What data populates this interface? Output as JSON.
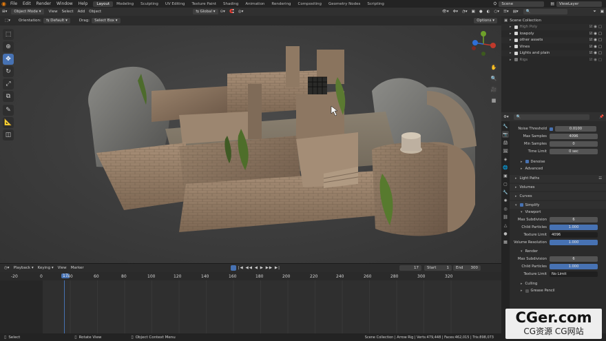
{
  "topbar": {
    "menu": [
      "File",
      "Edit",
      "Render",
      "Window",
      "Help"
    ],
    "workspaces": [
      "Layout",
      "Modeling",
      "Sculpting",
      "UV Editing",
      "Texture Paint",
      "Shading",
      "Animation",
      "Rendering",
      "Compositing",
      "Geometry Nodes",
      "Scripting"
    ],
    "active_workspace": "Layout",
    "scene": "Scene",
    "view_layer": "ViewLayer"
  },
  "viewport_header": {
    "mode": "Object Mode",
    "menu": [
      "View",
      "Select",
      "Add",
      "Object"
    ],
    "transform": "Global"
  },
  "viewport_tool": {
    "orientation_label": "Orientation:",
    "orientation_value": "Default",
    "drag_label": "Drag:",
    "drag_value": "Select Box",
    "options": "Options"
  },
  "toolbar_icons": [
    "select-box-icon",
    "cursor-icon",
    "move-icon",
    "rotate-icon",
    "scale-icon",
    "transform-icon",
    "annotate-icon",
    "measure-icon",
    "add-cube-icon"
  ],
  "outliner": {
    "root": "Scene Collection",
    "items": [
      "High Poly",
      "lowpoly",
      "other assets",
      "Vines",
      "Lights and plain",
      "Rigs"
    ]
  },
  "properties": {
    "noise_threshold_label": "Noise Threshold",
    "noise_threshold_value": "0.0100",
    "max_samples_label": "Max Samples",
    "max_samples_value": "4096",
    "min_samples_label": "Min Samples",
    "min_samples_value": "0",
    "time_limit_label": "Time Limit",
    "time_limit_value": "0 sec",
    "denoise": "Denoise",
    "advanced": "Advanced",
    "light_paths": "Light Paths",
    "volumes": "Volumes",
    "curves": "Curves",
    "simplify": "Simplify",
    "viewport": "Viewport",
    "vp_max_subdivision_label": "Max Subdivision",
    "vp_max_subdivision_value": "6",
    "vp_child_particles_label": "Child Particles",
    "vp_child_particles_value": "1.000",
    "vp_texture_limit_label": "Texture Limit",
    "vp_texture_limit_value": "4096",
    "vp_volume_resolution_label": "Volume Resolution",
    "vp_volume_resolution_value": "1.000",
    "render": "Render",
    "r_max_subdivision_label": "Max Subdivision",
    "r_max_subdivision_value": "6",
    "r_child_particles_label": "Child Particles",
    "r_child_particles_value": "1.000",
    "r_texture_limit_label": "Texture Limit",
    "r_texture_limit_value": "No Limit",
    "culling": "Culling",
    "grease_pencil": "Grease Pencil"
  },
  "timeline": {
    "menu": [
      "Playback",
      "Keying",
      "View",
      "Marker"
    ],
    "current_frame": "17",
    "start_label": "Start",
    "start_value": "1",
    "end_label": "End",
    "end_value": "300",
    "ruler": [
      "-20",
      "0",
      "17",
      "40",
      "60",
      "80",
      "100",
      "120",
      "140",
      "160",
      "180",
      "200",
      "220",
      "240",
      "260",
      "280",
      "300",
      "320"
    ]
  },
  "statusbar": {
    "left": "Select",
    "mid1": "Rotate View",
    "mid2": "Object Context Menu",
    "right": "Scene Collection | Arrow Rig | Verts:479,448 | Faces:462,015 | Tris:898,073"
  },
  "watermark": {
    "title": "CGer.com",
    "subtitle": "CG资源 CG网站"
  },
  "colors": {
    "accent": "#4772b3",
    "blender_orange": "#e87d0d"
  }
}
